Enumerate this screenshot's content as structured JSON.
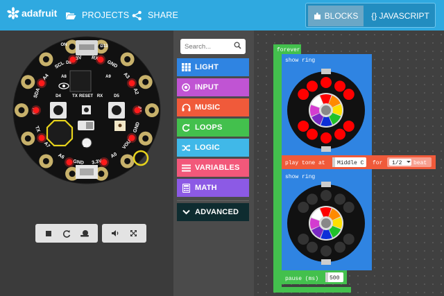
{
  "header": {
    "logo_text": "adafruit",
    "projects_label": "PROJECTS",
    "share_label": "SHARE",
    "blocks_label": "BLOCKS",
    "javascript_label": "{} JAVASCRIPT",
    "accent_color": "#2fa9e0"
  },
  "toolbox": {
    "search_placeholder": "Search...",
    "categories": [
      {
        "label": "LIGHT",
        "color": "#2f84e2",
        "icon": "grid-icon"
      },
      {
        "label": "INPUT",
        "color": "#c054d3",
        "icon": "radio-icon"
      },
      {
        "label": "MUSIC",
        "color": "#f05a3a",
        "icon": "headphones-icon"
      },
      {
        "label": "LOOPS",
        "color": "#43c04d",
        "icon": "refresh-icon"
      },
      {
        "label": "LOGIC",
        "color": "#40b8e8",
        "icon": "shuffle-icon"
      },
      {
        "label": "VARIABLES",
        "color": "#f2587a",
        "icon": "list-icon"
      },
      {
        "label": "MATH",
        "color": "#8c5ae5",
        "icon": "calculator-icon"
      },
      {
        "label": "ADVANCED",
        "color": "#0e2c30",
        "icon": "chevron-down-icon"
      }
    ]
  },
  "board": {
    "pin_labels": [
      "GND",
      "A6",
      "A7",
      "TX",
      "A5",
      "SDA",
      "A4",
      "SCL",
      "3.3V",
      "RX",
      "GND",
      "A3",
      "A2",
      "A1",
      "GND",
      "VOUT",
      "A0",
      "3.3V"
    ],
    "chip_labels": [
      "D4",
      "RESET",
      "RX",
      "TX",
      "D5",
      "D13",
      "D8",
      "D7",
      "A8",
      "A9",
      "ON"
    ]
  },
  "workspace": {
    "forever_label": "forever",
    "show_ring_label": "show ring",
    "play_tone_label": "play tone at",
    "tone_value": "Middle C",
    "for_label": "for",
    "duration_value": "1/2",
    "beat_label": "beat",
    "pause_label": "pause (ms)",
    "pause_value": "500",
    "ring1_colors": [
      "#ff0000",
      "#ff0000",
      "#ff0000",
      "#ff0000",
      "#ff0000",
      "#ff0000",
      "#ff0000",
      "#ff0000",
      "#ff0000",
      "#ff0000"
    ],
    "ring2_colors": [
      "#333333",
      "#333333",
      "#333333",
      "#333333",
      "#333333",
      "#333333",
      "#333333",
      "#333333",
      "#333333",
      "#333333"
    ]
  },
  "colors": {
    "loops_green": "#43c04d",
    "light_blue": "#2f84e2",
    "music_orange": "#f05a3a",
    "board_black": "#111111",
    "pad_gold": "#c7b16b"
  }
}
